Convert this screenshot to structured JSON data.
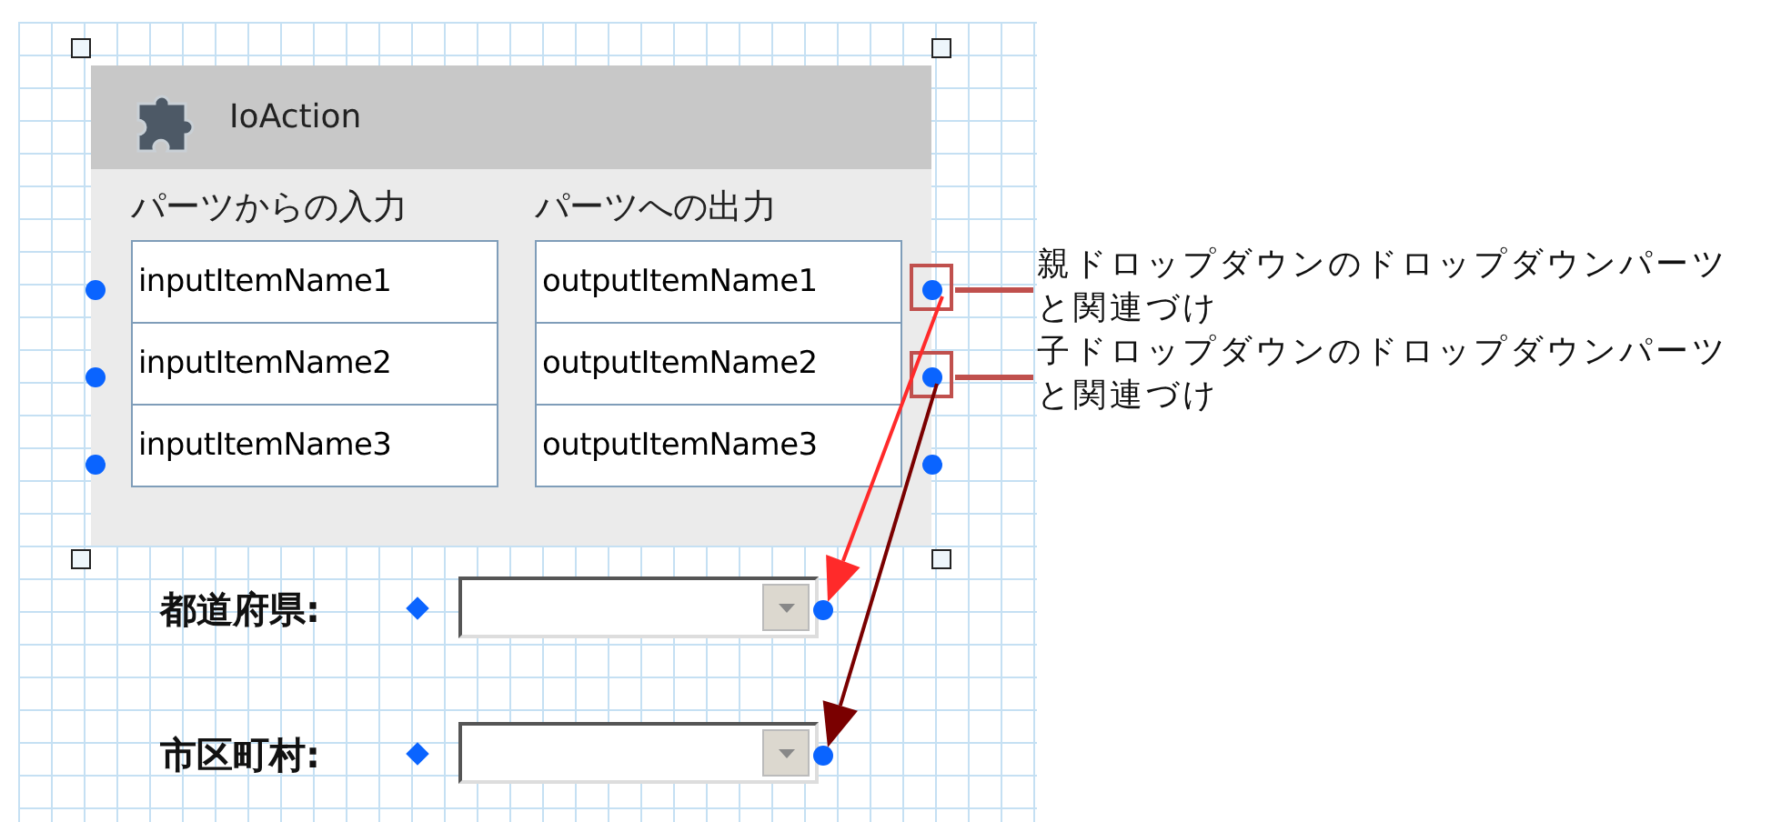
{
  "panel": {
    "title": "IoAction",
    "input_heading": "パーツからの入力",
    "output_heading": "パーツへの出力",
    "inputs": [
      "inputItemName1",
      "inputItemName2",
      "inputItemName3"
    ],
    "outputs": [
      "outputItemName1",
      "outputItemName2",
      "outputItemName3"
    ]
  },
  "dropdowns": [
    {
      "label": "都道府県:"
    },
    {
      "label": "市区町村:"
    }
  ],
  "connectors": [
    {
      "color": "#ff2a2a"
    },
    {
      "color": "#7a0000"
    }
  ],
  "annotations": [
    {
      "text": "親ドロップダウンのドロップダウンパーツと関連づけ"
    },
    {
      "text": "子ドロップダウンのドロップダウンパーツと関連づけ"
    }
  ]
}
